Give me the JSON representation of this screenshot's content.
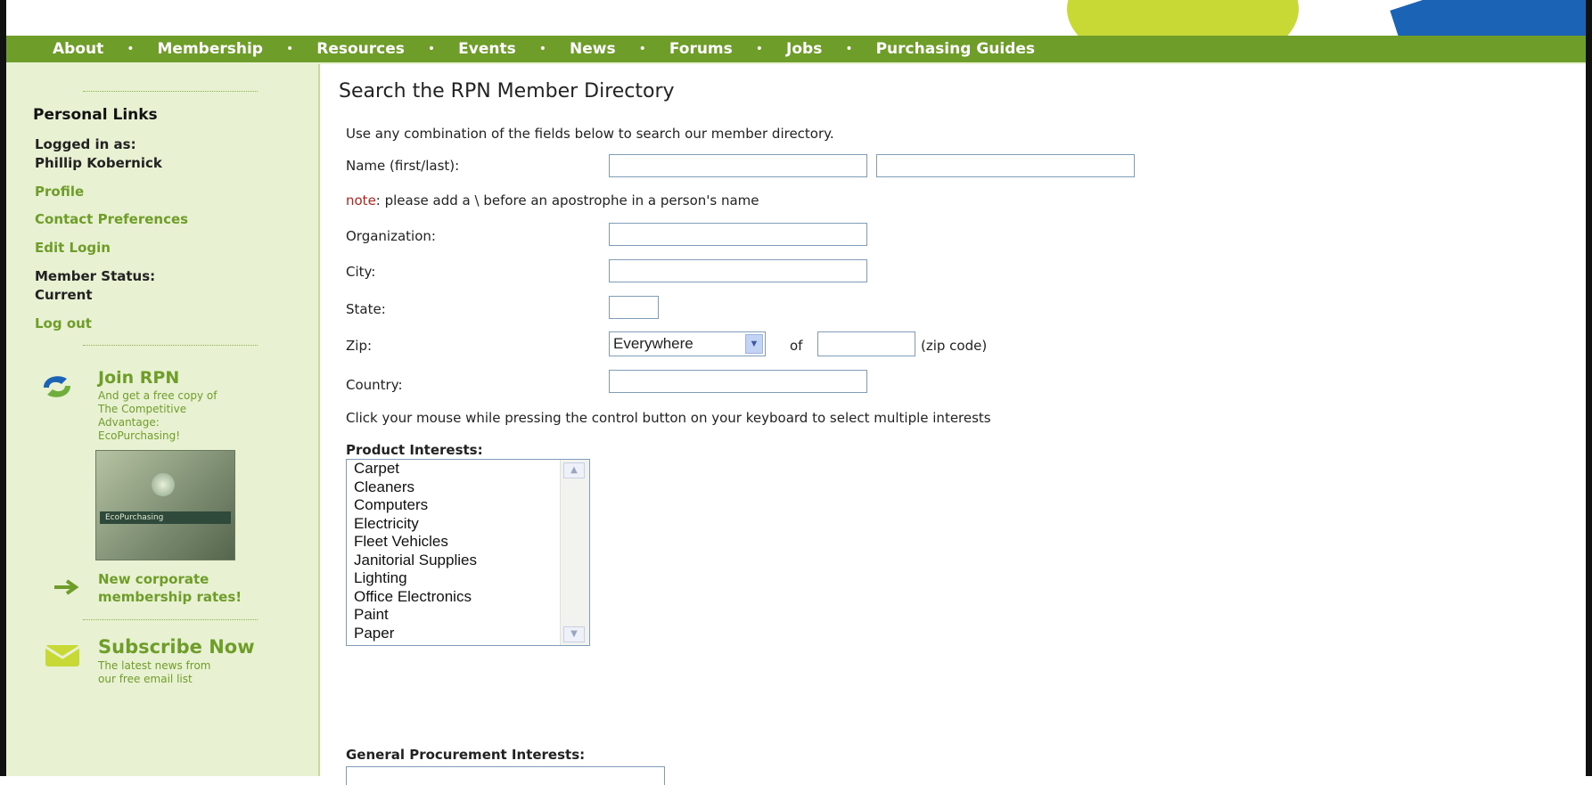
{
  "nav": {
    "items": [
      "About",
      "Membership",
      "Resources",
      "Events",
      "News",
      "Forums",
      "Jobs",
      "Purchasing Guides"
    ],
    "separator": "•"
  },
  "sidebar": {
    "section_title": "Personal Links",
    "logged_in_label": "Logged in as:",
    "user_name": "Phillip Kobernick",
    "links": {
      "profile": "Profile",
      "contact_preferences": "Contact Preferences",
      "edit_login": "Edit Login",
      "log_out": "Log out"
    },
    "member_status_label": "Member Status:",
    "member_status_value": "Current",
    "join": {
      "title": "Join RPN",
      "subtitle_lines": [
        "And get a free copy of",
        "The Competitive",
        "Advantage:",
        "EcoPurchasing!"
      ],
      "book_band": "EcoPurchasing"
    },
    "corporate": {
      "lines": [
        "New corporate",
        "membership rates!"
      ]
    },
    "subscribe": {
      "title": "Subscribe Now",
      "lines": [
        "The latest news from",
        "our free email list"
      ]
    }
  },
  "main": {
    "title": "Search the RPN Member Directory",
    "intro": "Use any combination of the fields below to search our member directory.",
    "fields": {
      "name_label": "Name (first/last):",
      "note_prefix": "note",
      "note_text": ": please add a \\ before an apostrophe in a person's name",
      "organization_label": "Organization:",
      "city_label": "City:",
      "state_label": "State:",
      "zip_label": "Zip:",
      "zip_range_selected": "Everywhere",
      "zip_of": "of",
      "zip_hint": "(zip code)",
      "country_label": "Country:"
    },
    "multi_select_hint": "Click your mouse while pressing the control button on your keyboard to select multiple interests",
    "product_interests_label": "Product Interests:",
    "product_interests": [
      "Carpet",
      "Cleaners",
      "Computers",
      "Electricity",
      "Fleet Vehicles",
      "Janitorial Supplies",
      "Lighting",
      "Office Electronics",
      "Paint",
      "Paper"
    ],
    "general_interests_label": "General Procurement Interests:"
  },
  "colors": {
    "brand_green": "#6f9d2a",
    "sidebar_bg": "#e9f1d3",
    "note_red": "#b5231f"
  }
}
